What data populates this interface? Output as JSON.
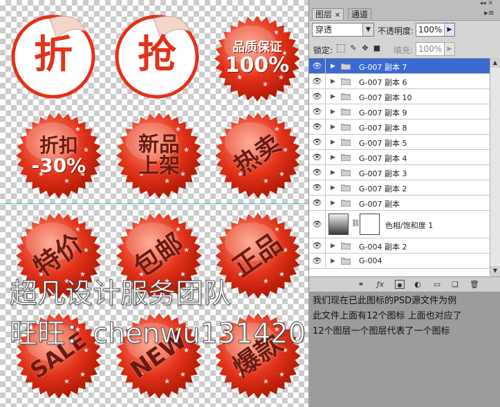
{
  "badges": [
    {
      "id": "zhe",
      "text": "折"
    },
    {
      "id": "qiang",
      "text": "抢"
    },
    {
      "id": "quality",
      "line1": "品质保证",
      "line2": "100%"
    },
    {
      "id": "discount",
      "line1": "折扣",
      "line2": "-30%"
    },
    {
      "id": "newitem",
      "line1": "新品",
      "line2": "上架"
    },
    {
      "id": "hot",
      "text": "热卖"
    },
    {
      "id": "special",
      "text": "特价"
    },
    {
      "id": "freeship",
      "text": "包邮"
    },
    {
      "id": "genuine",
      "text": "正品"
    },
    {
      "id": "sale",
      "text": "SALE"
    },
    {
      "id": "new",
      "text": "NEW"
    },
    {
      "id": "explosive",
      "text": "爆款"
    }
  ],
  "watermark": {
    "line1": "超凡设计服务团队",
    "line2": "旺旺：chenwu131420"
  },
  "panel": {
    "tabs": [
      {
        "label": "图层"
      },
      {
        "label": "通道"
      }
    ],
    "blend_mode": "穿透",
    "opacity_label": "不透明度:",
    "opacity_value": "100%",
    "lock_label": "锁定:",
    "fill_label": "填充:",
    "fill_value": "100%",
    "layers": [
      {
        "name": "G-007 副本 7",
        "selected": true
      },
      {
        "name": "G-007 副本 6"
      },
      {
        "name": "G-007 副本 10"
      },
      {
        "name": "G-007 副本 9"
      },
      {
        "name": "G-007 副本 8"
      },
      {
        "name": "G-007 副本 5"
      },
      {
        "name": "G-007 副本 4"
      },
      {
        "name": "G-007 副本 3"
      },
      {
        "name": "G-007 副本 2"
      },
      {
        "name": "G-007 副本"
      },
      {
        "name": "色相/饱和度 1",
        "adjustment": true
      },
      {
        "name": "G-004 副本 2"
      },
      {
        "name": "G-004"
      }
    ]
  },
  "description": {
    "line1": "我们现在已此图标的PSD源文件为例",
    "line2": "此文件上面有12个图标 上面也对应了",
    "line3": "12个图层一个图层代表了一个图标"
  },
  "colors": {
    "badge_red": "#e2321a",
    "selected_layer": "#3a6ad1",
    "guide": "#33cccc"
  }
}
